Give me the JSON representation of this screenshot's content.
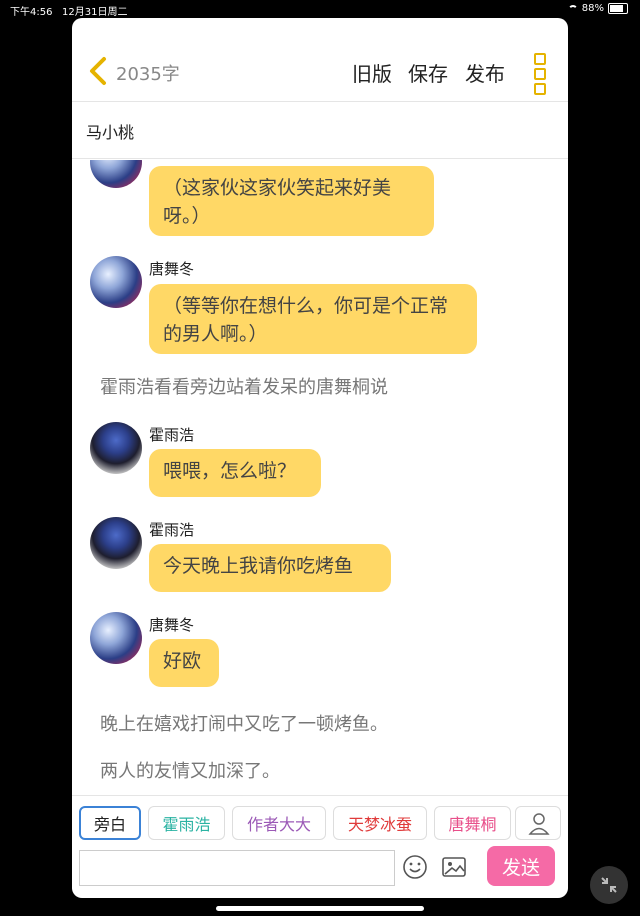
{
  "status": {
    "time": "下午4:56",
    "date": "12月31日周二",
    "battery": "88%"
  },
  "header": {
    "word_count": "2035字",
    "old_version": "旧版",
    "save": "保存",
    "publish": "发布"
  },
  "story": {
    "title": "马小桃"
  },
  "chat": {
    "messages": [
      {
        "type": "bubble",
        "speaker": "唐舞冬",
        "show_name": false,
        "text": "（这家伙这家伙笑起来好美呀。）"
      },
      {
        "type": "bubble",
        "speaker": "唐舞冬",
        "show_name": true,
        "text": "（等等你在想什么，你可是个正常的男人啊。）"
      },
      {
        "type": "narration",
        "text": "霍雨浩看看旁边站着发呆的唐舞桐说"
      },
      {
        "type": "bubble",
        "speaker": "霍雨浩",
        "show_name": true,
        "text": "喂喂，怎么啦？"
      },
      {
        "type": "bubble",
        "speaker": "霍雨浩",
        "show_name": true,
        "text": "今天晚上我请你吃烤鱼"
      },
      {
        "type": "bubble",
        "speaker": "唐舞冬",
        "show_name": true,
        "text": "好欧"
      },
      {
        "type": "narration",
        "text": "晚上在嬉戏打闹中又吃了一顿烤鱼。"
      },
      {
        "type": "narration",
        "text": "两人的友情又加深了。"
      }
    ]
  },
  "speakers": [
    {
      "label": "旁白",
      "color": "#222222"
    },
    {
      "label": "霍雨浩",
      "color": "#2bb3a3"
    },
    {
      "label": "作者大大",
      "color": "#9b59b6"
    },
    {
      "label": "天梦冰蚕",
      "color": "#e03b3b"
    },
    {
      "label": "唐舞桐",
      "color": "#e84f8a"
    }
  ],
  "composer": {
    "send": "发送",
    "placeholder": ""
  },
  "colors": {
    "accent": "#e5b300",
    "bubble": "#ffd866",
    "send": "#f56aa6",
    "selected_chip": "#3b82d6"
  },
  "icons": {
    "back": "chevron-left-icon",
    "more": "more-vertical-icon",
    "user": "user-icon",
    "emoji": "smile-icon",
    "image": "image-icon",
    "minimize": "minimize-icon"
  }
}
